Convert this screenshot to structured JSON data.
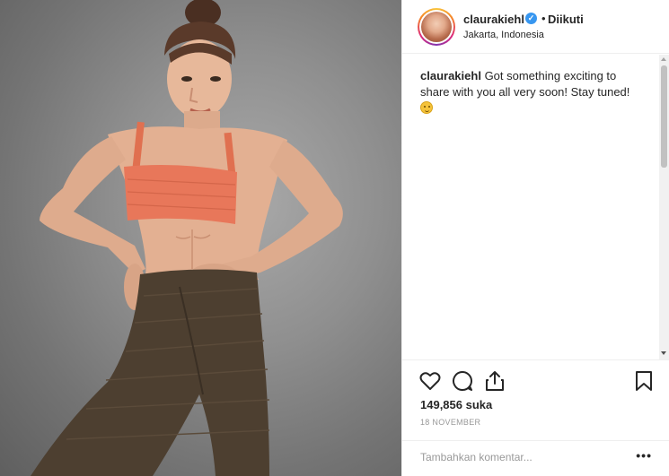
{
  "post": {
    "username": "claurakiehl",
    "verified": true,
    "separator": "•",
    "follow_label": "Diikuti",
    "location": "Jakarta, Indonesia",
    "caption_user": "claurakiehl",
    "caption_text": "Got something exciting to share with you all very soon! Stay tuned!",
    "caption_emoji": "wink-face-emoji",
    "likes": "149,856 suka",
    "date": "18 NOVEMBER"
  },
  "comment": {
    "placeholder": "Tambahkan komentar...",
    "more_label": "•••"
  },
  "icons": {
    "like": "heart-icon",
    "comment": "comment-bubble-icon",
    "share": "share-icon",
    "save": "bookmark-icon",
    "verified": "verified-badge-icon"
  },
  "colors": {
    "verified_blue": "#3897f0",
    "text": "#262626",
    "muted": "#999999",
    "border": "#efefef"
  }
}
